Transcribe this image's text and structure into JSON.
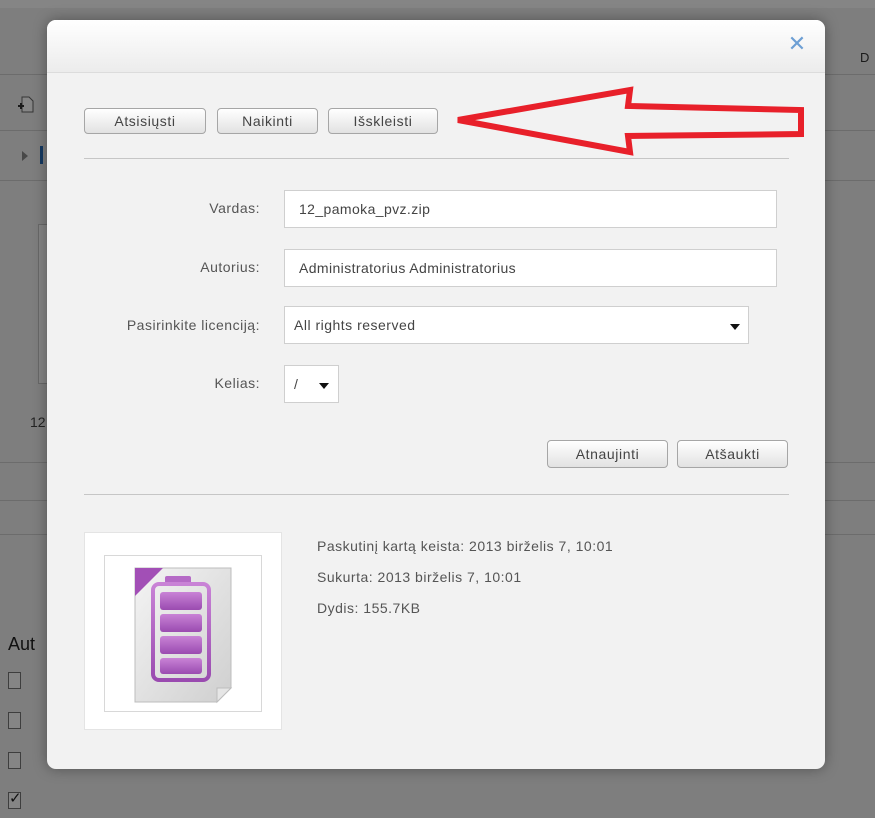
{
  "background": {
    "partial_number": "12",
    "partial_label": "Aut",
    "partial_right_label": "D"
  },
  "dialog": {
    "buttons": {
      "download": "Atsisiųsti",
      "delete": "Naikinti",
      "extract": "Išskleisti"
    },
    "form": {
      "name_label": "Vardas:",
      "name_value": "12_pamoka_pvz.zip",
      "author_label": "Autorius:",
      "author_value": "Administratorius Administratorius",
      "license_label": "Pasirinkite licenciją:",
      "license_value": "All rights reserved",
      "path_label": "Kelias:",
      "path_value": "/"
    },
    "actions": {
      "update": "Atnaujinti",
      "cancel": "Atšaukti"
    },
    "file_info": {
      "modified": "Paskutinį kartą keista: 2013 birželis 7, 10:01",
      "created": "Sukurta: 2013 birželis 7, 10:01",
      "size": "Dydis: 155.7KB"
    }
  },
  "icons": {
    "close": "close-icon",
    "file_type": "archive-file-icon",
    "annotation": "red-arrow-annotation"
  },
  "colors": {
    "annotation": "#e8202a",
    "file_icon_purple": "#a24fb6",
    "close_icon": "#6d9fd4"
  }
}
